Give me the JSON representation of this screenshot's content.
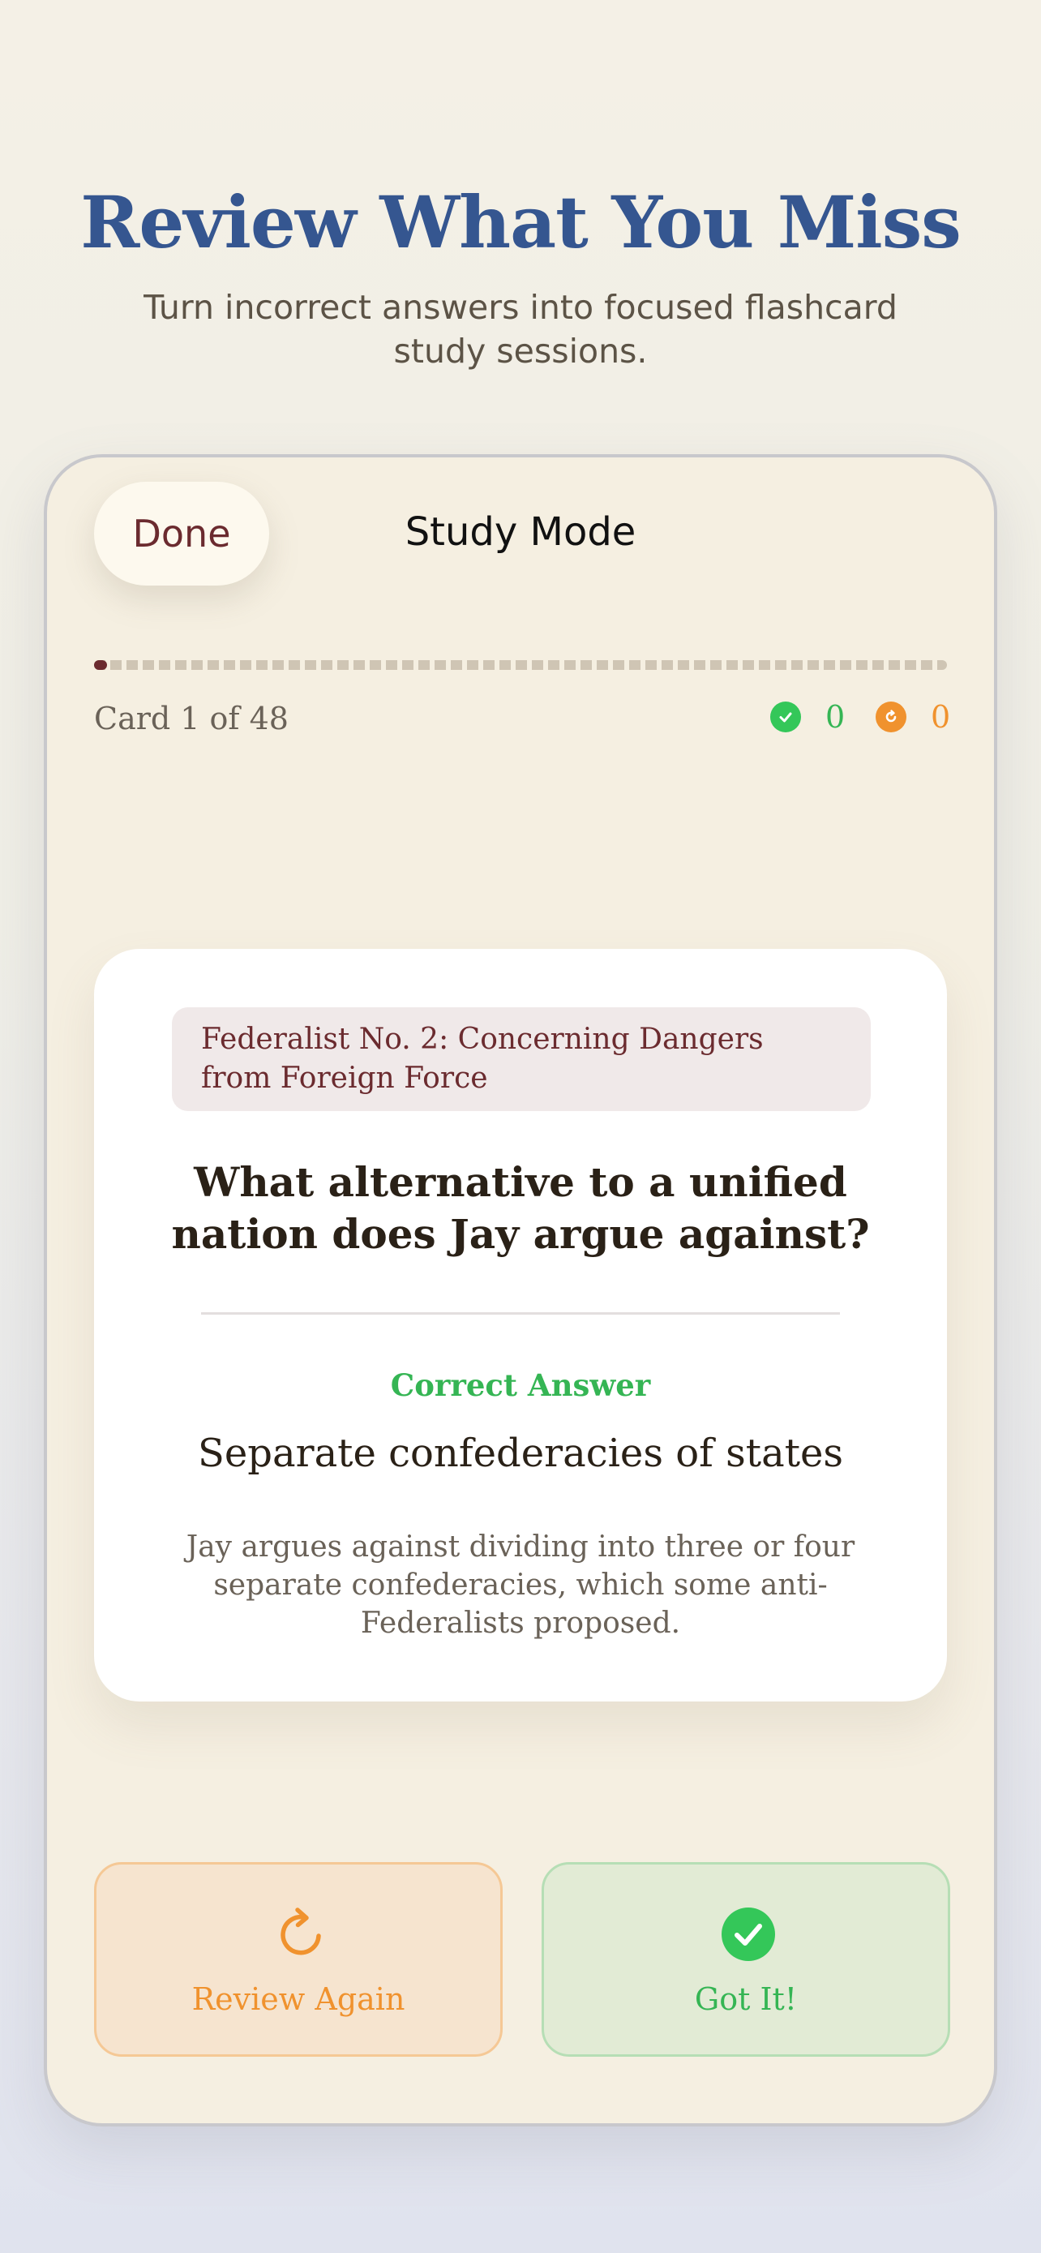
{
  "hero": {
    "title": "Review What You Miss",
    "subtitle": "Turn incorrect answers into focused flashcard study sessions."
  },
  "header": {
    "done_label": "Done",
    "title": "Study Mode"
  },
  "progress": {
    "card_counter": "Card 1 of 48",
    "current_card": 1,
    "total_cards": 48,
    "correct_count": "0",
    "review_count": "0"
  },
  "card": {
    "topic": "Federalist No. 2: Concerning Dangers from Foreign Force",
    "question": "What alternative to a unified nation does Jay argue against?",
    "answer_label": "Correct Answer",
    "answer": "Separate confederacies of states",
    "explanation": "Jay argues against dividing into three or four separate confederacies, which some anti-Federalists proposed."
  },
  "actions": {
    "review_again_label": "Review Again",
    "got_it_label": "Got It!"
  },
  "icons": {
    "correct": "checkmark-circle-icon",
    "review": "refresh-icon"
  },
  "colors": {
    "brand_blue": "#355690",
    "maroon": "#6b2b2f",
    "success_green": "#34c759",
    "review_orange": "#f0922e",
    "card_bg": "#f5efe1"
  }
}
